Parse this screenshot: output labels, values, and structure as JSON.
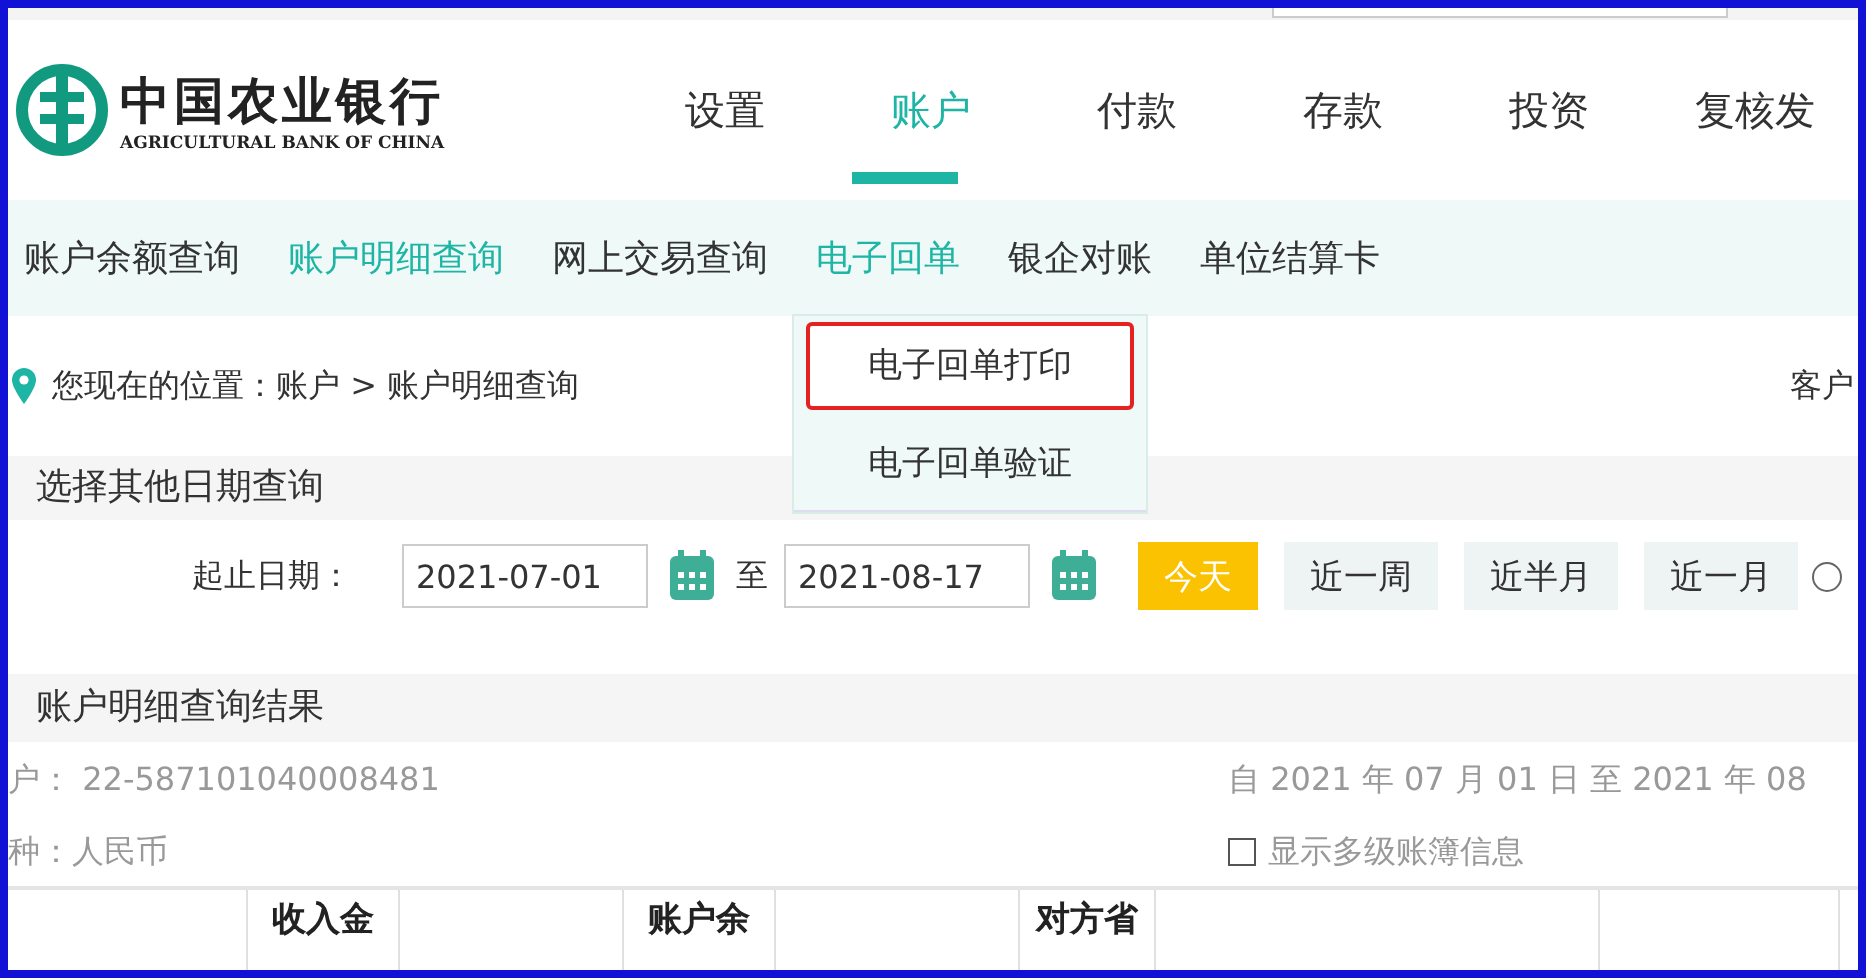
{
  "header": {
    "logo_title": "中国农业银行",
    "logo_subtitle": "AGRICULTURAL BANK OF CHINA"
  },
  "nav": [
    {
      "label": "设置",
      "selected": false
    },
    {
      "label": "账户",
      "selected": true
    },
    {
      "label": "付款",
      "selected": false
    },
    {
      "label": "存款",
      "selected": false
    },
    {
      "label": "投资",
      "selected": false
    },
    {
      "label": "复核发",
      "selected": false
    }
  ],
  "subnav": [
    {
      "label": "账户余额查询",
      "selected": false
    },
    {
      "label": "账户明细查询",
      "selected": true
    },
    {
      "label": "网上交易查询",
      "selected": false
    },
    {
      "label": "电子回单",
      "selected": true,
      "expanded": true,
      "menu": [
        {
          "label": "电子回单打印",
          "highlighted": true
        },
        {
          "label": "电子回单验证",
          "highlighted": false
        }
      ]
    },
    {
      "label": "银企对账",
      "selected": false
    },
    {
      "label": "单位结算卡",
      "selected": false
    }
  ],
  "breadcrumb": "您现在的位置：账户 > 账户明细查询",
  "customer_label": "客户",
  "date_section": {
    "title": "选择其他日期查询",
    "label": "起止日期：",
    "start": "2021-07-01",
    "separator": "至",
    "end": "2021-08-17",
    "buttons": [
      {
        "label": "今天",
        "selected": true
      },
      {
        "label": "近一周",
        "selected": false
      },
      {
        "label": "近半月",
        "selected": false
      },
      {
        "label": "近一月",
        "selected": false
      }
    ],
    "range_radio": {
      "checked": false
    }
  },
  "result": {
    "title": "账户明细查询结果",
    "account": "户： 22-587101040008481",
    "currency": "种：人民币",
    "period": "自 2021 年 07 月 01 日 至 2021 年 08",
    "show_multilevel": {
      "label": "显示多级账簿信息",
      "checked": false
    }
  },
  "table": {
    "columns": [
      {
        "kind": "cut"
      },
      {
        "kind": "text",
        "label": "收入金"
      },
      {
        "kind": "cut"
      },
      {
        "kind": "text",
        "label": "账户余"
      },
      {
        "kind": "cut"
      },
      {
        "kind": "text",
        "label": "对方省"
      },
      {
        "kind": "cut"
      },
      {
        "kind": "cut"
      }
    ]
  }
}
